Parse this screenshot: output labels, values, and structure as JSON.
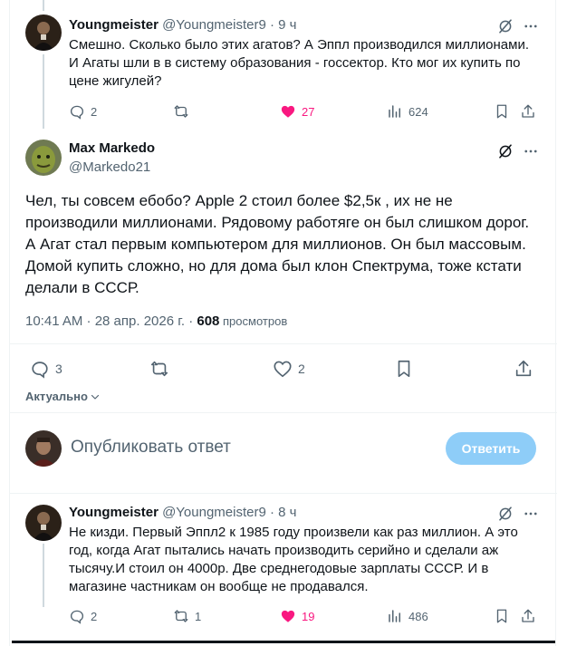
{
  "tweet1": {
    "name": "Youngmeister",
    "handle": "@Youngmeister9",
    "dot": "·",
    "time": "9 ч",
    "text": "Смешно. Сколько было этих агатов? А Эппл производился миллионами. И Агаты шли в в систему образования - госсектор. Кто мог их купить по цене жигулей?",
    "replies": "2",
    "likes": "27",
    "views": "624"
  },
  "main": {
    "name": "Max Markedo",
    "handle": "@Markedo21",
    "text": "Чел, ты совсем ебобо? Apple 2 стоил более $2,5к , их не не производили миллионами. Рядовому работяге он был слишком дорог. А Агат стал первым компьютером для миллионов. Он был массовым. Домой купить сложно, но для дома был клон Спектрума, тоже кстати делали в СССР.",
    "time": "10:41 AM · 28 апр. 2026 г. · ",
    "views_count": "608",
    "views_label": " просмотров",
    "replies": "3",
    "likes": "2"
  },
  "relevance": {
    "label": "Актуально"
  },
  "reply_box": {
    "placeholder": "Опубликовать ответ",
    "button": "Ответить"
  },
  "tweet2": {
    "name": "Youngmeister",
    "handle": "@Youngmeister9",
    "dot": "·",
    "time": "8 ч",
    "text": "Не кизди. Первый Эппл2 к 1985 году произвели как раз миллион. А это год, когда Агат пытались начать производить серийно и сделали аж тысячу.И стоил он 4000р. Две среднегодовые зарплаты СССР. И в магазине частникам он вообще не продавался.",
    "replies": "2",
    "retweets": "1",
    "likes": "19",
    "views": "486"
  },
  "colors": {
    "like_pink": "#f91880",
    "text_gray": "#536471",
    "button_blue": "#8ecdf8"
  }
}
